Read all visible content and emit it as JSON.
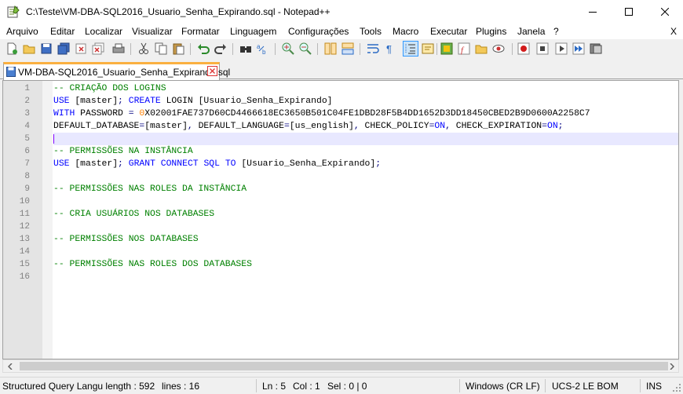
{
  "window": {
    "title": "C:\\Teste\\VM-DBA-SQL2016_Usuario_Senha_Expirando.sql - Notepad++"
  },
  "menu": {
    "items": [
      "Arquivo",
      "Editar",
      "Localizar",
      "Visualizar",
      "Formatar",
      "Linguagem",
      "Configurações",
      "Tools",
      "Macro",
      "Executar",
      "Plugins",
      "Janela",
      "?"
    ],
    "close_label": "X"
  },
  "tab": {
    "label": "VM-DBA-SQL2016_Usuario_Senha_Expirando.sql"
  },
  "editor": {
    "current_line": 5,
    "lines": [
      [
        {
          "t": "-- CRIAÇÃO DOS LOGINS",
          "c": "cm"
        }
      ],
      [
        {
          "t": "USE",
          "c": "kw"
        },
        {
          "t": " [master]",
          "c": "tx"
        },
        {
          "t": ";",
          "c": "op"
        },
        {
          "t": " ",
          "c": "tx"
        },
        {
          "t": "CREATE",
          "c": "kw"
        },
        {
          "t": " LOGIN [Usuario_Senha_Expirando]",
          "c": "tx"
        }
      ],
      [
        {
          "t": "WITH",
          "c": "kw"
        },
        {
          "t": " PASSWORD ",
          "c": "tx"
        },
        {
          "t": "=",
          "c": "op"
        },
        {
          "t": " ",
          "c": "tx"
        },
        {
          "t": "0",
          "c": "hx"
        },
        {
          "t": "X02001FAE737D60CD4466618EC3650B501C04FE1DBD28F5B4DD1652D3DD18450CBED2B9D0600A2258C7",
          "c": "tx"
        }
      ],
      [
        {
          "t": "DEFAULT_DATABASE",
          "c": "tx"
        },
        {
          "t": "=",
          "c": "op"
        },
        {
          "t": "[master]",
          "c": "tx"
        },
        {
          "t": ",",
          "c": "op"
        },
        {
          "t": " DEFAULT_LANGUAGE",
          "c": "tx"
        },
        {
          "t": "=",
          "c": "op"
        },
        {
          "t": "[us_english]",
          "c": "tx"
        },
        {
          "t": ",",
          "c": "op"
        },
        {
          "t": " CHECK_POLICY",
          "c": "tx"
        },
        {
          "t": "=",
          "c": "op"
        },
        {
          "t": "ON",
          "c": "kw"
        },
        {
          "t": ",",
          "c": "op"
        },
        {
          "t": " CHECK_EXPIRATION",
          "c": "tx"
        },
        {
          "t": "=",
          "c": "op"
        },
        {
          "t": "ON",
          "c": "kw"
        },
        {
          "t": ";",
          "c": "op"
        }
      ],
      [],
      [
        {
          "t": "-- PERMISSÕES NA INSTÂNCIA",
          "c": "cm"
        }
      ],
      [
        {
          "t": "USE",
          "c": "kw"
        },
        {
          "t": " [master]",
          "c": "tx"
        },
        {
          "t": ";",
          "c": "op"
        },
        {
          "t": " ",
          "c": "tx"
        },
        {
          "t": "GRANT",
          "c": "kw"
        },
        {
          "t": " ",
          "c": "tx"
        },
        {
          "t": "CONNECT",
          "c": "kw"
        },
        {
          "t": " ",
          "c": "tx"
        },
        {
          "t": "SQL",
          "c": "kw"
        },
        {
          "t": " ",
          "c": "tx"
        },
        {
          "t": "TO",
          "c": "kw"
        },
        {
          "t": " [Usuario_Senha_Expirando]",
          "c": "tx"
        },
        {
          "t": ";",
          "c": "op"
        }
      ],
      [],
      [
        {
          "t": "-- PERMISSÕES NAS ROLES DA INSTÂNCIA",
          "c": "cm"
        }
      ],
      [],
      [
        {
          "t": "-- CRIA USUÁRIOS NOS DATABASES",
          "c": "cm"
        }
      ],
      [],
      [
        {
          "t": "-- PERMISSÕES NOS DATABASES",
          "c": "cm"
        }
      ],
      [],
      [
        {
          "t": "-- PERMISSÕES NAS ROLES DOS DATABASES",
          "c": "cm"
        }
      ],
      []
    ]
  },
  "status": {
    "language_length": "Structured Query Langu length : 592",
    "lines": "lines : 16",
    "ln": "Ln : 5",
    "col": "Col : 1",
    "sel": "Sel : 0 | 0",
    "eol": "Windows (CR LF)",
    "encoding": "UCS-2 LE BOM",
    "mode": "INS"
  },
  "toolbar": {
    "icons": [
      "new-file-icon",
      "open-file-icon",
      "save-icon",
      "save-all-icon",
      "close-icon",
      "close-all-icon",
      "print-icon",
      "cut-icon",
      "copy-icon",
      "paste-icon",
      "undo-icon",
      "redo-icon",
      "find-icon",
      "replace-icon",
      "zoom-in-icon",
      "zoom-out-icon",
      "sync-vertical-icon",
      "sync-horizontal-icon",
      "word-wrap-icon",
      "show-all-chars-icon",
      "indent-guide-icon",
      "language-icon",
      "doc-map-icon",
      "function-list-icon",
      "folder-workspace-icon",
      "monitoring-icon",
      "record-macro-icon",
      "stop-record-icon",
      "play-macro-icon",
      "run-macro-multiple-icon",
      "save-macro-icon"
    ]
  }
}
